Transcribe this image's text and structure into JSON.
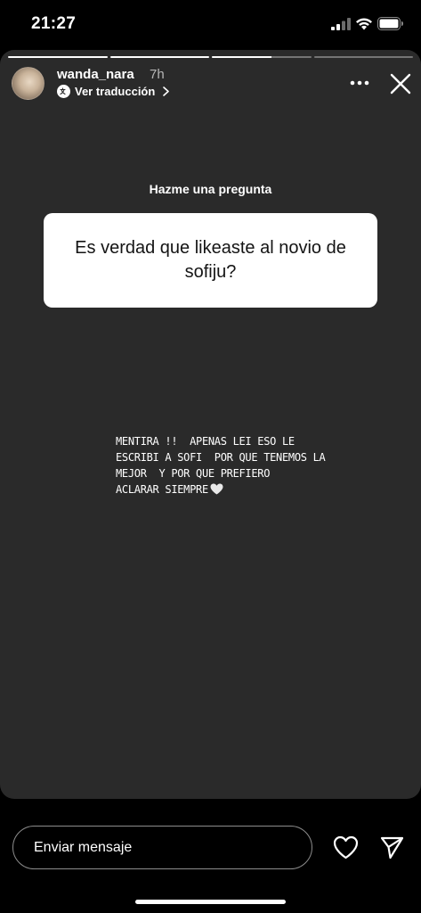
{
  "status_bar": {
    "time": "21:27"
  },
  "story": {
    "progress": {
      "segments_total": 3,
      "current_segment_fraction": 0.6
    },
    "header": {
      "username": "wanda_nara",
      "time_ago": "7h",
      "translate_label": "Ver traducción"
    },
    "question_sticker": {
      "label": "Hazme una pregunta",
      "question": "Es verdad que likeaste al novio de sofiju?"
    },
    "caption": "MENTIRA !!  APENAS LEI ESO LE\nESCRIBI A SOFI  POR QUE TENEMOS LA\nMEJOR  Y POR QUE PREFIERO\nACLARAR SIEMPRE",
    "icons": {
      "more": "more-icon",
      "close": "close-icon",
      "caption_heart": "white-heart-emoji"
    }
  },
  "reply_bar": {
    "placeholder": "Enviar mensaje",
    "like_icon": "heart-icon",
    "send_icon": "send-icon"
  },
  "colors": {
    "story_background": "#2a2a2a",
    "page_background": "#000000",
    "card_background": "#ffffff"
  }
}
